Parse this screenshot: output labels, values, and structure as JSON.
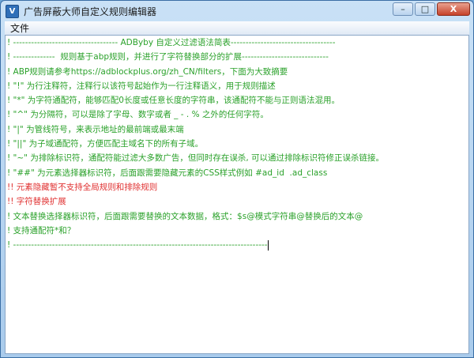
{
  "window": {
    "title": "广告屏蔽大师自定义规则编辑器",
    "icon_glyph": "V",
    "minimize_glyph": "–",
    "maximize_glyph": "□",
    "close_glyph": "X"
  },
  "menu": {
    "items": [
      {
        "label": "文件"
      }
    ]
  },
  "editor": {
    "lines": [
      {
        "text": "! ----------------------------------- ADByby 自定义过滤语法简表-----------------------------------",
        "color": "green"
      },
      {
        "text": "! --------------  规则基于abp规则，并进行了字符替换部分的扩展-----------------------------",
        "color": "green"
      },
      {
        "text": "! ABP规则请参考https://adblockplus.org/zh_CN/filters，下面为大致摘要",
        "color": "green"
      },
      {
        "text": "! \"!\" 为行注释符，注释行以该符号起始作为一行注释语义，用于规则描述",
        "color": "green"
      },
      {
        "text": "! \"*\" 为字符通配符，能够匹配0长度或任意长度的字符串，该通配符不能与正则语法混用。",
        "color": "green"
      },
      {
        "text": "! \"^\" 为分隔符，可以是除了字母、数字或者 _ - . % 之外的任何字符。",
        "color": "green"
      },
      {
        "text": "! \"|\" 为管线符号，来表示地址的最前端或最末端",
        "color": "green"
      },
      {
        "text": "! \"||\" 为子域通配符，方便匹配主域名下的所有子域。",
        "color": "green"
      },
      {
        "text": "! \"~\" 为排除标识符，通配符能过滤大多数广告，但同时存在误杀, 可以通过排除标识符修正误杀链接。",
        "color": "green"
      },
      {
        "text": "! \"##\" 为元素选择器标识符，后面跟需要隐藏元素的CSS样式例如 #ad_id  .ad_class",
        "color": "green"
      },
      {
        "text": "!! 元素隐藏暂不支持全局规则和排除规则",
        "color": "red"
      },
      {
        "text": "!! 字符替换扩展",
        "color": "red"
      },
      {
        "text": "! 文本替换选择器标识符，后面跟需要替换的文本数据，格式：$s@模式字符串@替换后的文本@",
        "color": "green"
      },
      {
        "text": "! 支持通配符*和？",
        "color": "green"
      },
      {
        "text": "! -------------------------------------------------------------------------------------",
        "color": "green"
      }
    ]
  },
  "colors": {
    "comment_green": "#2aa12a",
    "comment_red": "#e03030"
  }
}
